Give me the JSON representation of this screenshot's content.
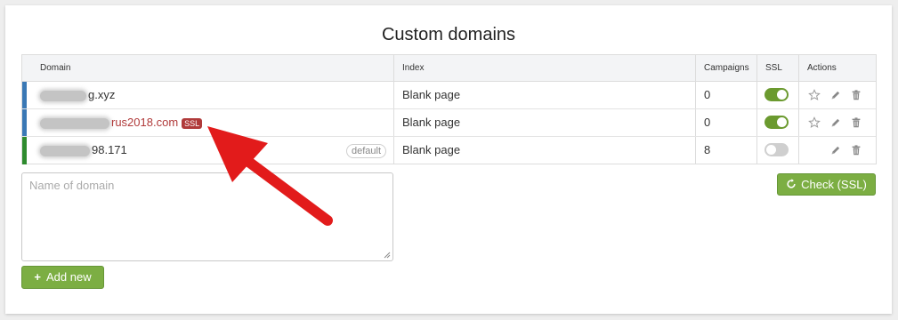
{
  "page": {
    "title": "Custom domains"
  },
  "table": {
    "columns": {
      "domain": "Domain",
      "index": "Index",
      "campaigns": "Campaigns",
      "ssl": "SSL",
      "actions": "Actions"
    },
    "rows": [
      {
        "domain_suffix": "g.xyz",
        "ssl_badge": "",
        "default_label": "",
        "index": "Blank page",
        "campaigns": "0",
        "ssl_on": true,
        "bar_color": "#3a78b5",
        "domain_color": "#333333"
      },
      {
        "domain_suffix": "rus2018.com",
        "ssl_badge": "SSL",
        "default_label": "",
        "index": "Blank page",
        "campaigns": "0",
        "ssl_on": true,
        "bar_color": "#3a78b5",
        "domain_color": "#b03a3a"
      },
      {
        "domain_suffix": "98.171",
        "ssl_badge": "",
        "default_label": "default",
        "index": "Blank page",
        "campaigns": "8",
        "ssl_on": false,
        "bar_color": "#2e8b2e",
        "domain_color": "#333333"
      }
    ]
  },
  "form": {
    "domain_placeholder": "Name of domain",
    "add_new_label": "Add new",
    "check_ssl_label": "Check (SSL)"
  },
  "colors": {
    "accent_green": "#7cae43",
    "toggle_on": "#6b9a2f",
    "ssl_badge": "#b03a3a",
    "annotation_arrow": "#e21b1b"
  },
  "icons": {
    "favorite": "star-icon",
    "edit": "pencil-icon",
    "delete": "trash-icon",
    "refresh": "refresh-icon",
    "add": "plus-icon"
  }
}
